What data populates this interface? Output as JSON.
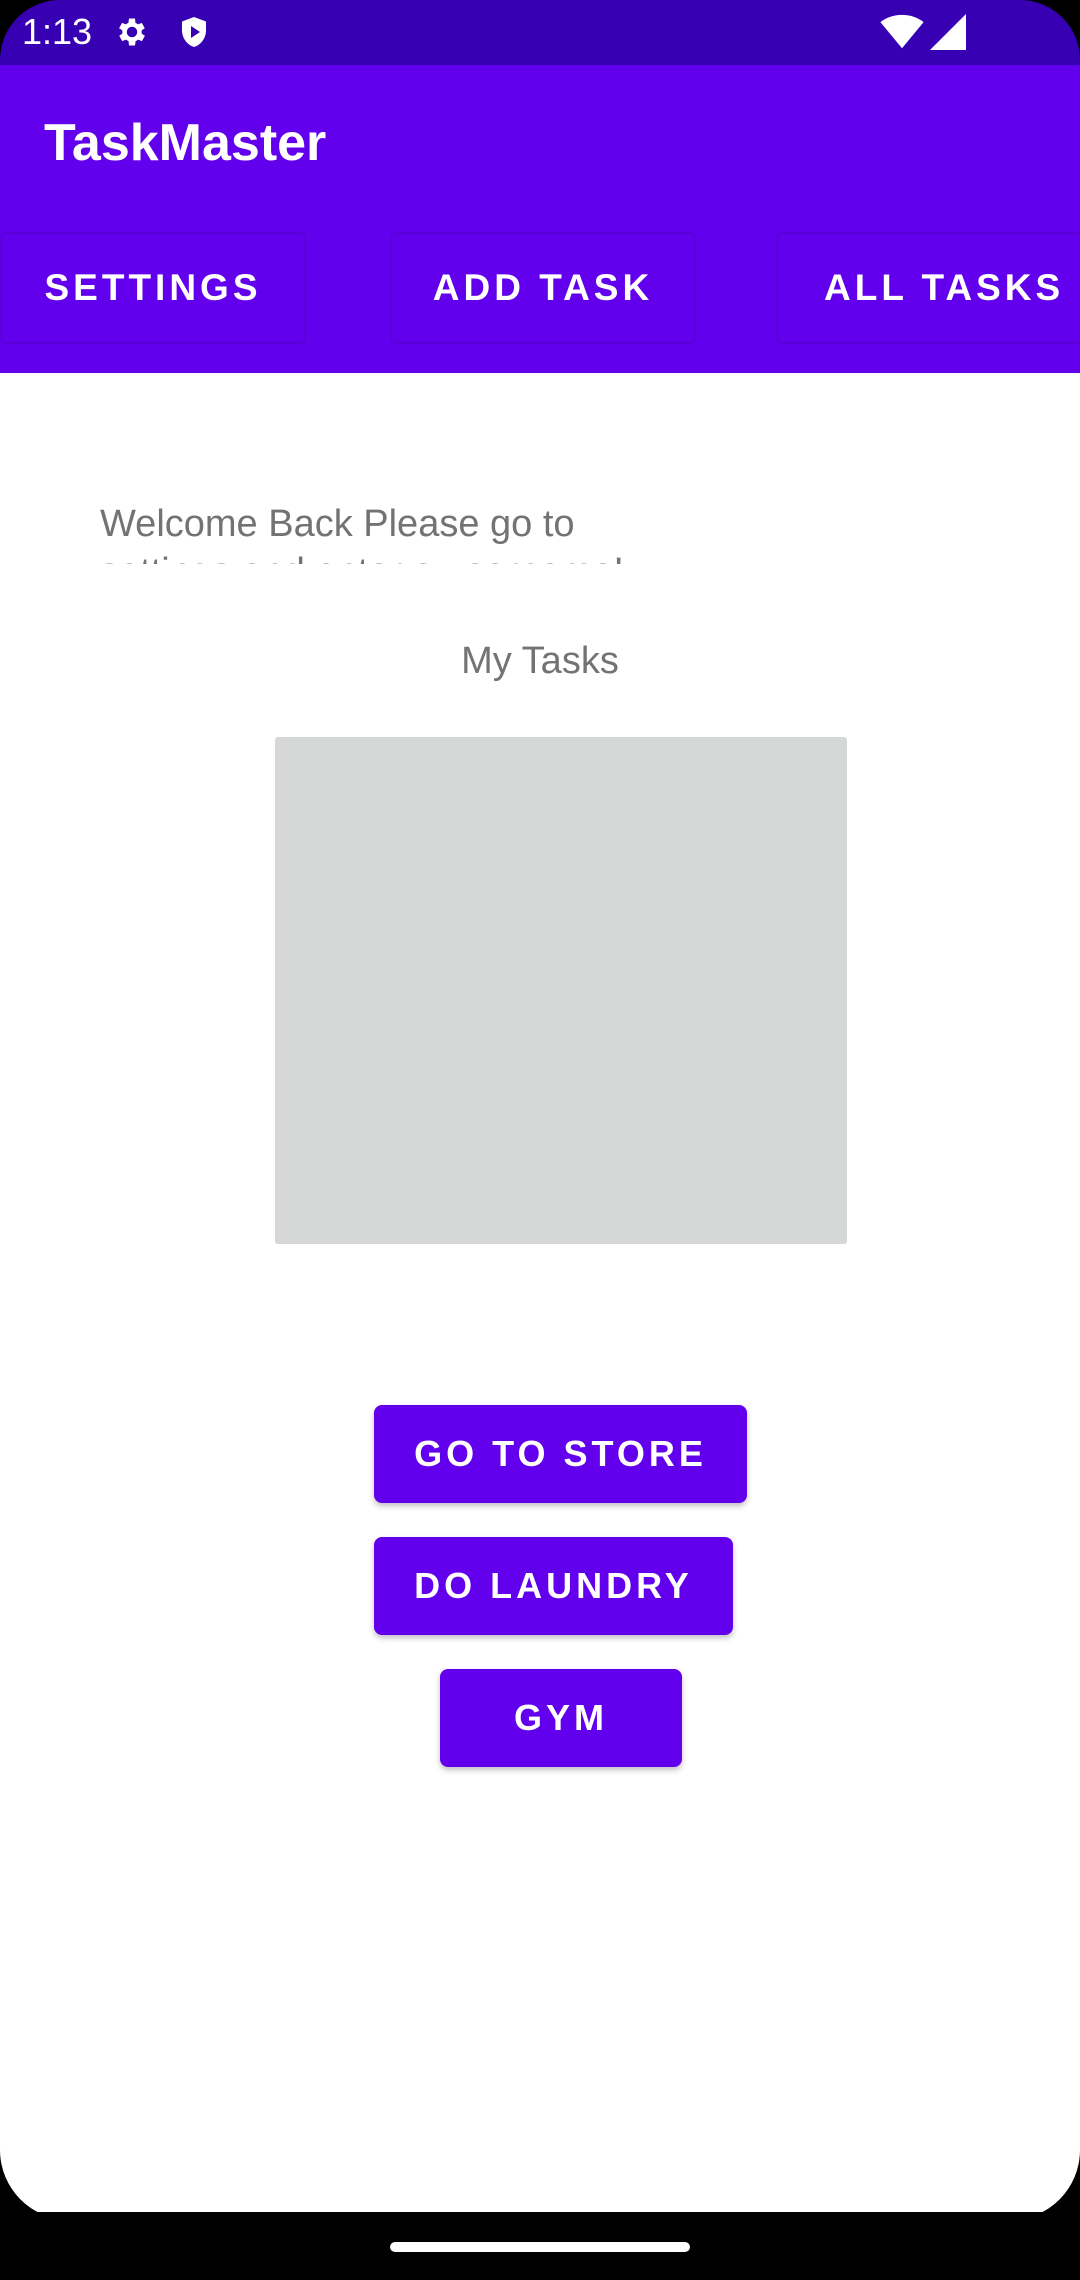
{
  "status_bar": {
    "time": "1:13",
    "icons": [
      "gear-icon",
      "shield-play-icon",
      "wifi-icon",
      "cellular-signal-icon"
    ]
  },
  "app_bar": {
    "title": "TaskMaster"
  },
  "tabs": [
    {
      "label": "SETTINGS"
    },
    {
      "label": "ADD TASK"
    },
    {
      "label": "ALL TASKS"
    }
  ],
  "main": {
    "welcome_text": "Welcome Back Please go to settings and enter a username!",
    "my_tasks_title": "My Tasks"
  },
  "task_buttons": [
    {
      "label": "GO TO STORE"
    },
    {
      "label": "DO LAUNDRY"
    },
    {
      "label": "GYM"
    }
  ],
  "colors": {
    "status_bar": "#3700b3",
    "primary": "#6200ee",
    "list_placeholder": "#d6d7d7",
    "secondary_text": "#737373"
  }
}
